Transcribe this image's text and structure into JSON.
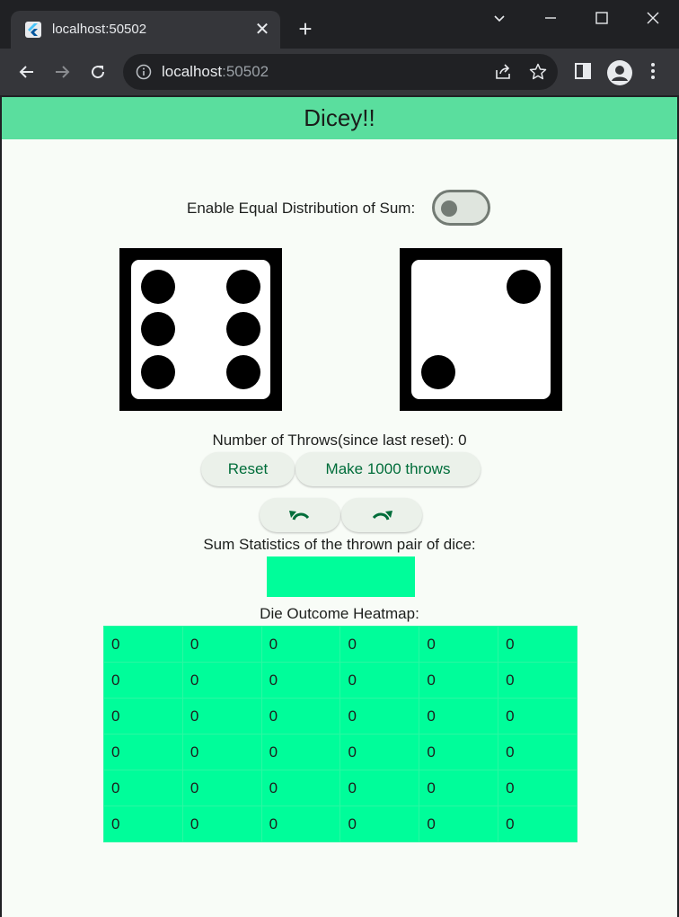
{
  "browser": {
    "tab_title": "localhost:50502",
    "url_host": "localhost",
    "url_port": ":50502"
  },
  "app": {
    "title": "Dicey!!",
    "toggle_label": "Enable Equal Distribution of Sum:",
    "toggle_on": false,
    "dice": [
      6,
      2
    ],
    "throws_label": "Number of Throws(since last reset): 0",
    "reset_label": "Reset",
    "make_throws_label": "Make 1000 throws",
    "sum_stats_label": "Sum Statistics of the thrown pair of dice:",
    "heatmap_label": "Die Outcome Heatmap:",
    "heatmap_color": "#00fd9a",
    "heatmap": [
      [
        "0",
        "0",
        "0",
        "0",
        "0",
        "0"
      ],
      [
        "0",
        "0",
        "0",
        "0",
        "0",
        "0"
      ],
      [
        "0",
        "0",
        "0",
        "0",
        "0",
        "0"
      ],
      [
        "0",
        "0",
        "0",
        "0",
        "0",
        "0"
      ],
      [
        "0",
        "0",
        "0",
        "0",
        "0",
        "0"
      ],
      [
        "0",
        "0",
        "0",
        "0",
        "0",
        "0"
      ]
    ]
  },
  "colors": {
    "appbar": "#5ade9e",
    "accent": "#006d3a",
    "page_bg": "#f8fcf7"
  }
}
